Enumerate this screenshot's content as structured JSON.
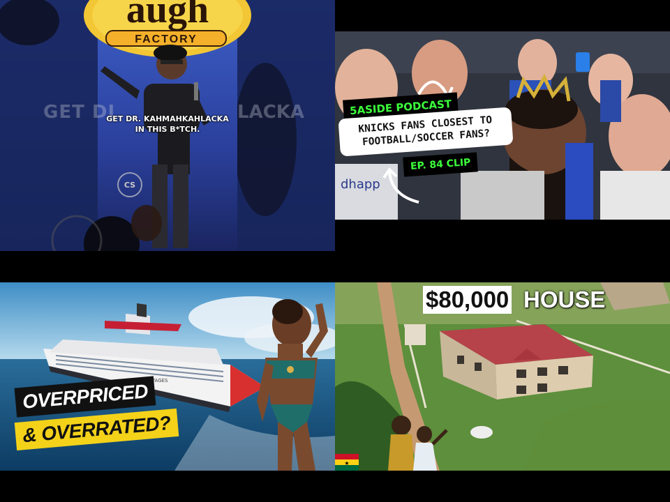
{
  "tiles": [
    {
      "name": "comedy-clip",
      "caption_line1": "GET DR. KAHMAHKAHLACKA",
      "caption_line2": "IN THIS B*TCH.",
      "ghost_left": "GET DI",
      "ghost_right": "LACKA",
      "sign_word": "augh",
      "sign_sub": "FACTORY",
      "logo_text": "CS"
    },
    {
      "name": "knicks-podcast",
      "badge": "5ASIDE PODCAST",
      "title_line1": "KNICKS FANS CLOSEST TO",
      "title_line2": "FOOTBALL/SOCCER FANS?",
      "episode": "EP. 84 CLIP",
      "shirt_text": "dhapp"
    },
    {
      "name": "cruise-review",
      "line1": "OVERPRICED",
      "line2": "& OVERRATED?",
      "ship_name": "VOYAGES"
    },
    {
      "name": "ghana-house",
      "price": "$80,000",
      "word": "HOUSE"
    }
  ],
  "colors": {
    "podcast_green": "#3cff3c",
    "cruise_yellow": "#f4d21a",
    "roof_red": "#b6424a"
  }
}
